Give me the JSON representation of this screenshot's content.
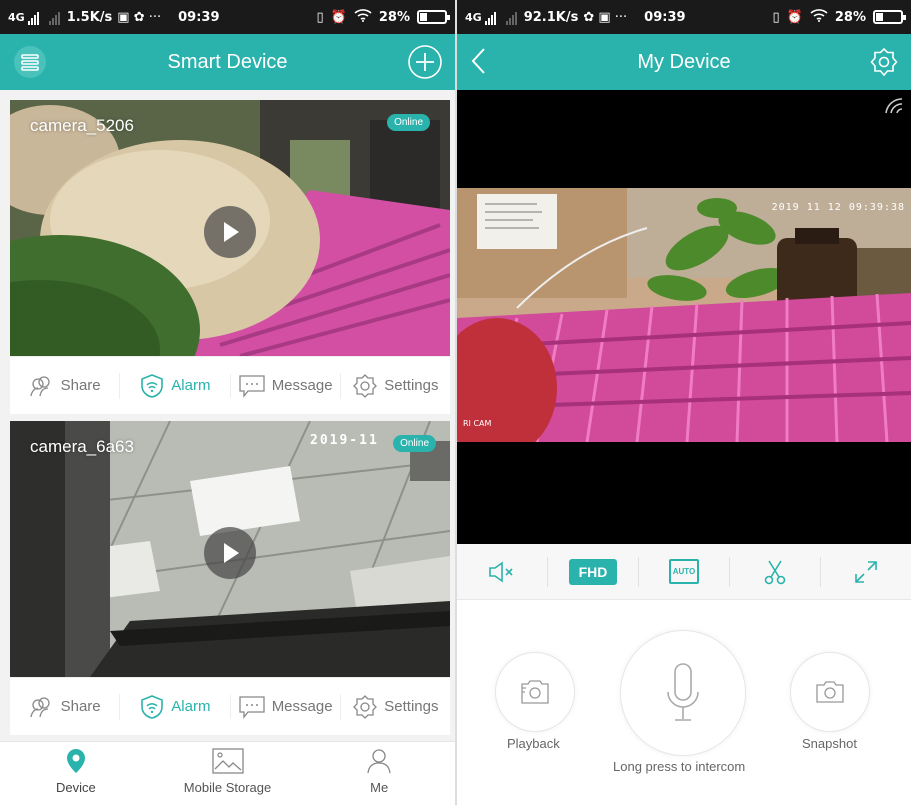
{
  "left": {
    "status": {
      "network": "4G",
      "speed": "1.5K/s",
      "time": "09:39",
      "battery": "28%",
      "battery_level": 0.28
    },
    "header": {
      "title": "Smart Device",
      "menu_icon": "list-menu-icon",
      "add_icon": "plus-circle-icon"
    },
    "cameras": [
      {
        "name": "camera_5206",
        "status": "Online",
        "osd_time": ""
      },
      {
        "name": "camera_6a63",
        "status": "Online",
        "osd_time": "2019-11"
      }
    ],
    "actions": {
      "share": "Share",
      "alarm": "Alarm",
      "message": "Message",
      "settings": "Settings"
    },
    "tabs": [
      {
        "label": "Device",
        "icon": "location-pin-icon",
        "active": true
      },
      {
        "label": "Mobile Storage",
        "icon": "image-icon",
        "active": false
      },
      {
        "label": "Me",
        "icon": "user-icon",
        "active": false
      }
    ]
  },
  "right": {
    "status": {
      "network": "4G",
      "speed": "92.1K/s",
      "time": "09:39",
      "battery": "28%",
      "battery_level": 0.28
    },
    "header": {
      "title": "My Device",
      "back_icon": "chevron-left-icon",
      "settings_icon": "gear-icon"
    },
    "video": {
      "osd_time": "2019 11 12 09:39:38",
      "cam_label": "RI CAM"
    },
    "toolbar": {
      "quality": "FHD",
      "auto": "AUTO"
    },
    "controls": {
      "playback": "Playback",
      "intercom": "Long press to intercom",
      "snapshot": "Snapshot"
    }
  },
  "colors": {
    "accent": "#2ab3ac",
    "statusbar": "#1a1a1a",
    "text_gray": "#777777"
  }
}
